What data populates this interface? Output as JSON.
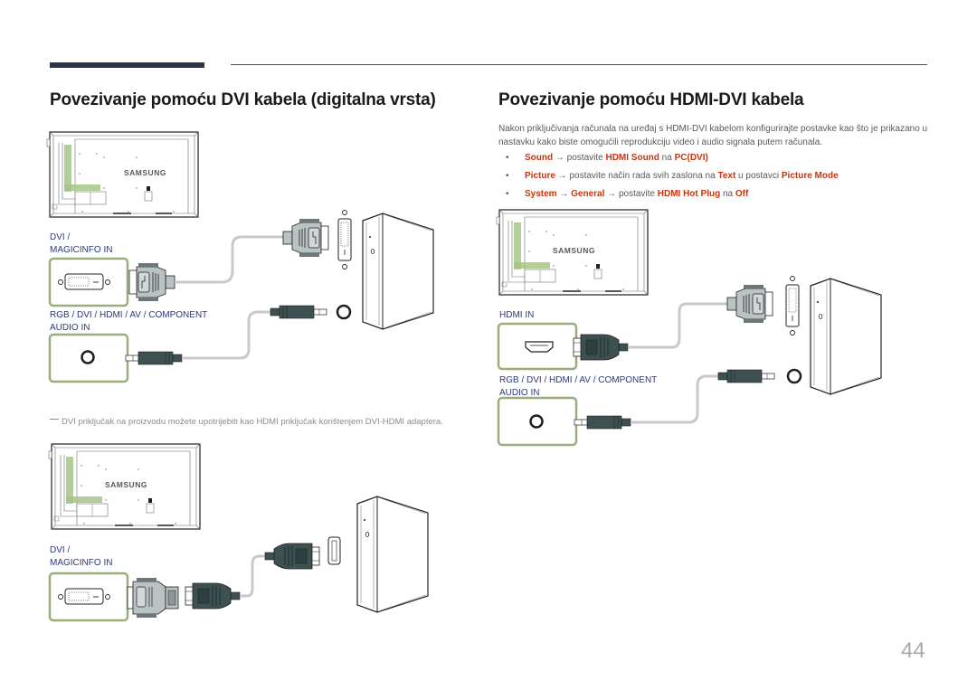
{
  "header": {
    "left_title": "Povezivanje pomoću DVI kabela (digitalna vrsta)",
    "right_title": "Povezivanje pomoću HDMI-DVI kabela"
  },
  "right_section": {
    "intro": "Nakon priključivanja računala na uređaj s HDMI-DVI kabelom konfigurirajte postavke kao što je prikazano u nastavku kako biste omogućili reprodukciju video i audio signala putem računala.",
    "bullets": [
      {
        "parts": [
          {
            "text": "Sound",
            "kw": true
          },
          {
            "text": " → postavite ",
            "kw": false
          },
          {
            "text": "HDMI Sound",
            "kw": true
          },
          {
            "text": " na ",
            "kw": false
          },
          {
            "text": "PC(DVI)",
            "kw": true
          }
        ]
      },
      {
        "parts": [
          {
            "text": "Picture",
            "kw": true
          },
          {
            "text": " → postavite način rada svih zaslona na ",
            "kw": false
          },
          {
            "text": "Text",
            "kw": true
          },
          {
            "text": " u postavci ",
            "kw": false
          },
          {
            "text": "Picture Mode",
            "kw": true
          }
        ]
      },
      {
        "parts": [
          {
            "text": "System",
            "kw": true
          },
          {
            "text": " → ",
            "kw": false
          },
          {
            "text": "General",
            "kw": true
          },
          {
            "text": " → postavite ",
            "kw": false
          },
          {
            "text": "HDMI Hot Plug",
            "kw": true
          },
          {
            "text": " na ",
            "kw": false
          },
          {
            "text": "Off",
            "kw": true
          }
        ]
      }
    ],
    "bullet_symbol": "•"
  },
  "diagrams": {
    "brand": "SAMSUNG",
    "dvi_diagram": {
      "port_label_line1": "DVI /",
      "port_label_line2": "MAGICINFO IN",
      "audio_label_line1": "RGB / DVI / HDMI / AV / COMPONENT",
      "audio_label_line2": "AUDIO IN"
    },
    "note": "DVI priključak na proizvodu možete upotrijebiti kao HDMI priključak korištenjem DVI-HDMI adaptera.",
    "adapter_diagram": {
      "port_label_line1": "DVI /",
      "port_label_line2": "MAGICINFO IN"
    },
    "hdmi_dvi_diagram": {
      "port_label": "HDMI IN",
      "audio_label_line1": "RGB / DVI / HDMI / AV / COMPONENT",
      "audio_label_line2": "AUDIO IN"
    }
  },
  "colors": {
    "heading_bar": "#2e3447",
    "keyword": "#c8340c",
    "port_label": "#2d3a74",
    "port_box_border": "#9aae7a",
    "connector_dark": "#3d5152",
    "connector_light": "#b9c3c4",
    "highlight_green": "#a6c48a"
  },
  "footer": {
    "page_number": "44"
  }
}
